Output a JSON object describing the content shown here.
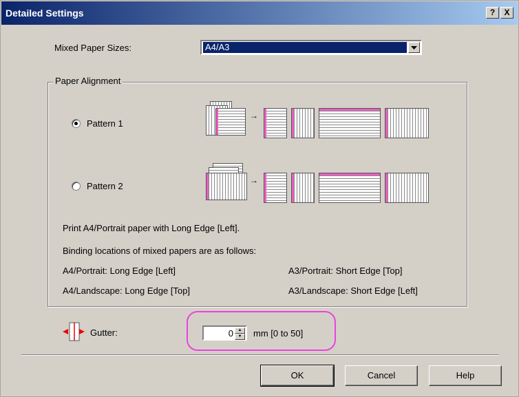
{
  "dialog": {
    "title": "Detailed Settings",
    "help_label": "?",
    "close_label": "X"
  },
  "mixed_paper": {
    "label": "Mixed Paper Sizes:",
    "value": "A4/A3"
  },
  "alignment": {
    "legend": "Paper Alignment",
    "pattern1_label": "Pattern 1",
    "pattern2_label": "Pattern 2",
    "pattern1_selected": true,
    "arrow_glyph": "→"
  },
  "info": {
    "line1": "Print A4/Portrait paper with Long Edge [Left].",
    "line2": "Binding locations of mixed papers are as follows:",
    "a4_portrait": "A4/Portrait: Long Edge [Left]",
    "a3_portrait": "A3/Portrait: Short Edge [Top]",
    "a4_landscape": "A4/Landscape: Long Edge [Top]",
    "a3_landscape": "A3/Landscape: Short Edge [Left]"
  },
  "gutter": {
    "label": "Gutter:",
    "value": "0",
    "range": "mm [0 to 50]"
  },
  "buttons": {
    "ok": "OK",
    "cancel": "Cancel",
    "help": "Help"
  },
  "colors": {
    "title_bar": "#0a246a",
    "highlight": "#ee41e0",
    "binding": "#e85fc2"
  }
}
